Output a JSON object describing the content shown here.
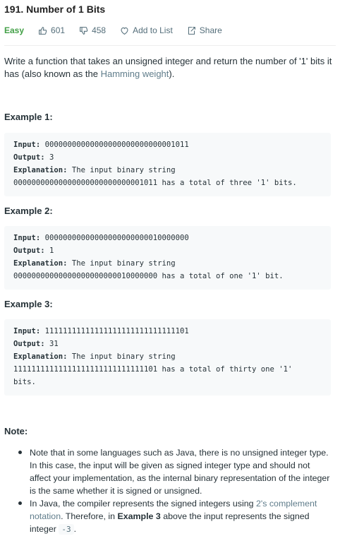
{
  "problem": {
    "title": "191. Number of 1 Bits",
    "difficulty": "Easy",
    "likes": "601",
    "dislikes": "458",
    "add_to_list_label": "Add to List",
    "share_label": "Share"
  },
  "description": {
    "text_before_link": "Write a function that takes an unsigned integer and return the number of '1' bits it has (also known as the ",
    "link_text": "Hamming weight",
    "text_after_link": ")."
  },
  "examples": [
    {
      "title": "Example 1:",
      "input_label": "Input:",
      "input_value": " 00000000000000000000000000001011",
      "output_label": "Output:",
      "output_value": " 3",
      "explanation_label": "Explanation:",
      "explanation_line1": " The input binary string",
      "explanation_line2": "00000000000000000000000000001011 has a total of three '1' bits."
    },
    {
      "title": "Example 2:",
      "input_label": "Input:",
      "input_value": " 00000000000000000000000010000000",
      "output_label": "Output:",
      "output_value": " 1",
      "explanation_label": "Explanation:",
      "explanation_line1": " The input binary string",
      "explanation_line2": "00000000000000000000000010000000 has a total of one '1' bit."
    },
    {
      "title": "Example 3:",
      "input_label": "Input:",
      "input_value": " 11111111111111111111111111111101",
      "output_label": "Output:",
      "output_value": " 31",
      "explanation_label": "Explanation:",
      "explanation_line1": " The input binary string",
      "explanation_line2": "11111111111111111111111111111101 has a total of thirty one '1'",
      "explanation_line3": "bits."
    }
  ],
  "note": {
    "title": "Note:",
    "item1": "Note that in some languages such as Java, there is no unsigned integer type. In this case, the input will be given as signed integer type and should not affect your implementation, as the internal binary representation of the integer is the same whether it is signed or unsigned.",
    "item2_before_link": "In Java, the compiler represents the signed integers using ",
    "item2_link": "2's complement notation",
    "item2_middle": ". Therefore, in ",
    "item2_bold": "Example 3",
    "item2_after_bold": " above the input represents the signed integer ",
    "item2_code": "-3",
    "item2_end": "."
  },
  "colors": {
    "difficulty_easy": "#43a047",
    "link": "#607d8b",
    "code_bg": "#f7f9fa"
  },
  "icons": {
    "like": "thumbs-up-icon",
    "dislike": "thumbs-down-icon",
    "add_to_list": "heart-icon",
    "share": "share-icon"
  }
}
